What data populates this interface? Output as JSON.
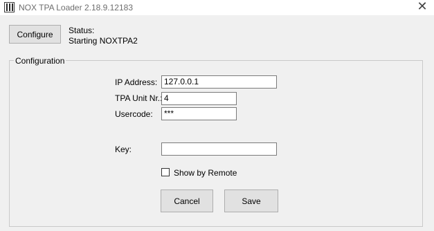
{
  "window": {
    "title": "NOX TPA Loader 2.18.9.12183",
    "close_glyph": "✕"
  },
  "toolbar": {
    "configure_label": "Configure",
    "status_label": "Status:",
    "status_value": "Starting NOXTPA2"
  },
  "configuration": {
    "group_title": "Configuration",
    "ip_label": "IP Address:",
    "ip_value": "127.0.0.1",
    "unit_label": "TPA Unit Nr.:",
    "unit_value": "4",
    "usercode_label": "Usercode:",
    "usercode_value": "***",
    "key_label": "Key:",
    "key_value": "",
    "show_remote_label": "Show by Remote",
    "show_remote_checked": false
  },
  "actions": {
    "cancel_label": "Cancel",
    "save_label": "Save"
  }
}
